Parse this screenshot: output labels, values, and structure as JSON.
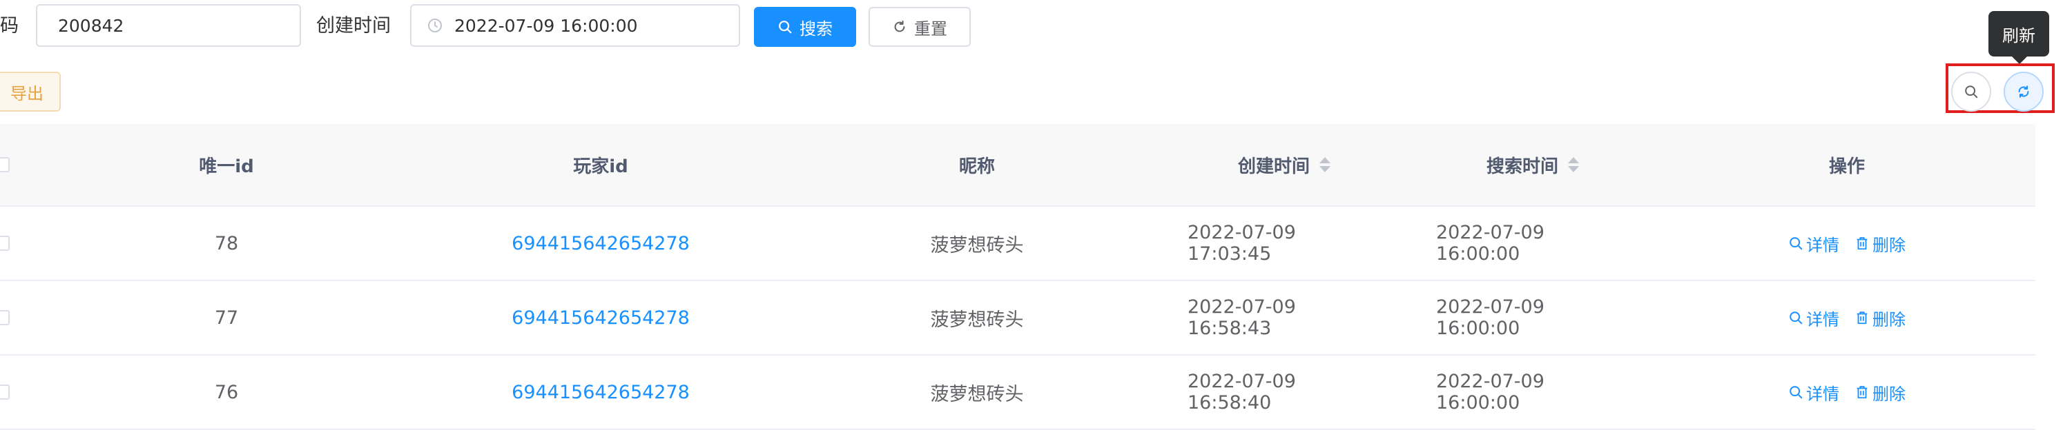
{
  "filters": {
    "code_label": "码",
    "code_value": "200842",
    "created_label": "创建时间",
    "created_value": "2022-07-09 16:00:00",
    "search_label": "搜索",
    "reset_label": "重置"
  },
  "toolbar": {
    "export_label": "导出",
    "refresh_tooltip": "刷新",
    "search_toggle_icon": "search-icon",
    "refresh_icon": "refresh-icon"
  },
  "table": {
    "columns": [
      "唯一id",
      "玩家id",
      "昵称",
      "创建时间",
      "搜索时间",
      "操作"
    ],
    "rows": [
      {
        "uid": "78",
        "player_id": "694415642654278",
        "nickname": "菠萝想砖头",
        "created": "2022-07-09 17:03:45",
        "searched": "2022-07-09 16:00:00",
        "detail": "详情",
        "delete": "删除"
      },
      {
        "uid": "77",
        "player_id": "694415642654278",
        "nickname": "菠萝想砖头",
        "created": "2022-07-09 16:58:43",
        "searched": "2022-07-09 16:00:00",
        "detail": "详情",
        "delete": "删除"
      },
      {
        "uid": "76",
        "player_id": "694415642654278",
        "nickname": "菠萝想砖头",
        "created": "2022-07-09 16:58:40",
        "searched": "2022-07-09 16:00:00",
        "detail": "详情",
        "delete": "删除"
      }
    ]
  },
  "colors": {
    "primary": "#1890ff",
    "warning": "#e6a23c",
    "highlight": "#e01e1e",
    "tooltip_bg": "#303133"
  }
}
